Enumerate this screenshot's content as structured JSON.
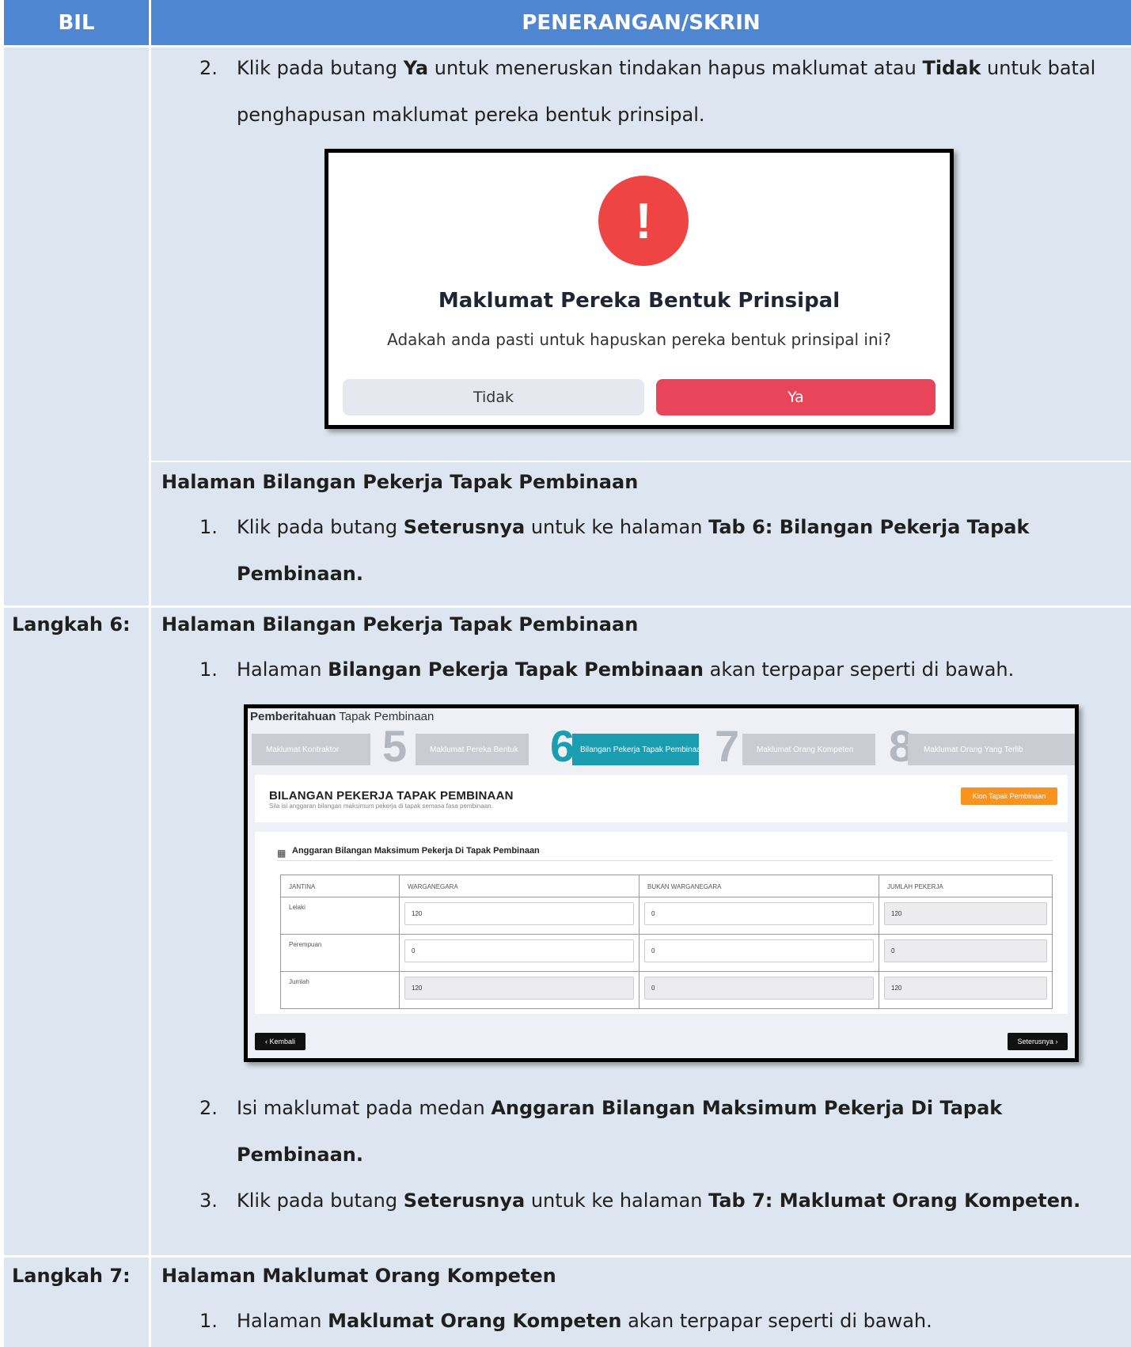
{
  "header": {
    "bil": "BIL",
    "penerangan": "PENERANGAN/SKRIN"
  },
  "row1": {
    "item2_num": "2.",
    "item2_a": "Klik pada butang ",
    "item2_ya": "Ya",
    "item2_b": " untuk meneruskan tindakan hapus maklumat atau ",
    "item2_tidak": "Tidak",
    "item2_c": " untuk batal",
    "item2_line2": "penghapusan maklumat pereka bentuk prinsipal.",
    "dialog": {
      "icon": "!",
      "title": "Maklumat Pereka Bentuk Prinsipal",
      "message": "Adakah anda pasti untuk hapuskan pereka bentuk prinsipal ini?",
      "no_label": "Tidak",
      "yes_label": "Ya"
    },
    "section_heading": "Halaman Bilangan Pekerja Tapak Pembinaan",
    "item1_num": "1.",
    "item1_a": "Klik pada butang ",
    "item1_seterusnya": "Seterusnya",
    "item1_b": " untuk ke halaman ",
    "item1_tab": "Tab 6: Bilangan Pekerja Tapak",
    "item1_line2": "Pembinaan."
  },
  "row2": {
    "step_label": "Langkah 6:",
    "heading": "Halaman Bilangan Pekerja Tapak Pembinaan",
    "item1_num": "1.",
    "item1_a": "Halaman ",
    "item1_bold": "Bilangan Pekerja Tapak Pembinaan",
    "item1_b": " akan terpapar seperti di bawah.",
    "app": {
      "title_bold": "Pemberitahuan",
      "title_rest": " Tapak Pembinaan",
      "tabs": [
        {
          "label": "Maklumat Kontraktor",
          "num": ""
        },
        {
          "label": "Maklumat Pereka Bentuk",
          "num": "5"
        },
        {
          "label": "Bilangan Pekerja Tapak Pembinaan",
          "num": "6"
        },
        {
          "label": "Maklumat Orang Kompeten",
          "num": "7"
        },
        {
          "label": "Maklumat Orang Yang Terlib",
          "num": "8"
        }
      ],
      "section_title": "BILANGAN PEKERJA TAPAK PEMBINAAN",
      "section_sub": "Sila isi anggaran bilangan maksimum pekerja di tapak semasa fasa pembinaan.",
      "klon_label": "Klon Tapak Pembinaan",
      "anggaran_title": "Anggaran Bilangan Maksimum Pekerja Di Tapak Pembinaan",
      "table": {
        "headers": [
          "JANTINA",
          "WARGANEGARA",
          "BUKAN WARGANEGARA",
          "JUMLAH PEKERJA"
        ],
        "rows": [
          [
            "Lelaki",
            "120",
            "0",
            "120"
          ],
          [
            "Perempuan",
            "0",
            "0",
            "0"
          ],
          [
            "Jumlah",
            "120",
            "0",
            "120"
          ]
        ]
      },
      "kembali_label": "‹ Kembali",
      "seterusnya_label": "Seterusnya ›"
    },
    "item2_num": "2.",
    "item2_a": "Isi maklumat pada medan ",
    "item2_bold": "Anggaran Bilangan Maksimum Pekerja Di Tapak",
    "item2_line2": "Pembinaan.",
    "item3_num": "3.",
    "item3_a": "Klik pada butang ",
    "item3_seterusnya": "Seterusnya",
    "item3_b": " untuk ke halaman ",
    "item3_tab": "Tab 7: Maklumat Orang Kompeten."
  },
  "row3": {
    "step_label": "Langkah 7:",
    "heading": "Halaman Maklumat Orang Kompeten",
    "item1_num": "1.",
    "item1_a": "Halaman ",
    "item1_bold": "Maklumat Orang Kompeten",
    "item1_b": " akan terpapar seperti di bawah."
  }
}
